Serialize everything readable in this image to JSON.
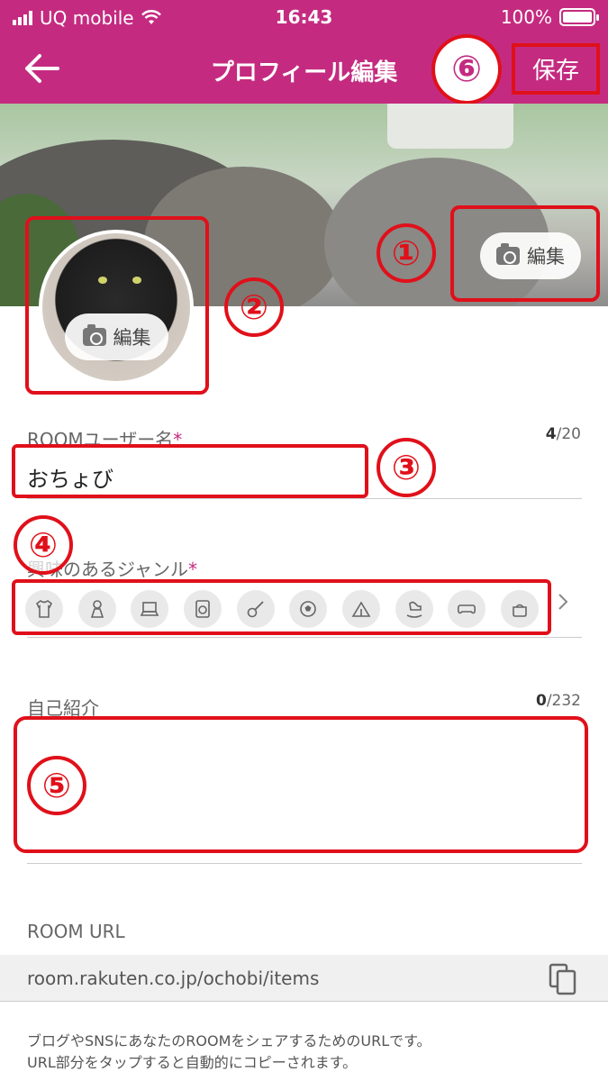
{
  "status": {
    "carrier": "UQ mobile",
    "time": "16:43",
    "battery": "100%"
  },
  "nav": {
    "title": "プロフィール編集",
    "save": "保存"
  },
  "cover": {
    "edit_label": "編集"
  },
  "avatar": {
    "edit_label": "編集"
  },
  "markers": [
    "①",
    "②",
    "③",
    "④",
    "⑤",
    "⑥"
  ],
  "username": {
    "label": "ROOMユーザー名",
    "required": "*",
    "value": "おちょび",
    "count": "4",
    "max": "/20"
  },
  "genre": {
    "label": "興味のあるジャンル",
    "required": "*",
    "icons": [
      "shirt-icon",
      "dress-icon",
      "laptop-icon",
      "washer-icon",
      "guitar-icon",
      "ball-icon",
      "tent-icon",
      "rocking-horse-icon",
      "gamepad-icon",
      "pot-icon"
    ]
  },
  "bio": {
    "label": "自己紹介",
    "count": "0",
    "max": "/232",
    "value": ""
  },
  "url": {
    "label": "ROOM URL",
    "value": "room.rakuten.co.jp/ochobi/items",
    "note1": "ブログやSNSにあなたのROOMをシェアするためのURLです。",
    "note2": "URL部分をタップすると自動的にコピーされます。"
  },
  "colors": {
    "brand": "#c42b80",
    "annotation": "#e0101a"
  }
}
